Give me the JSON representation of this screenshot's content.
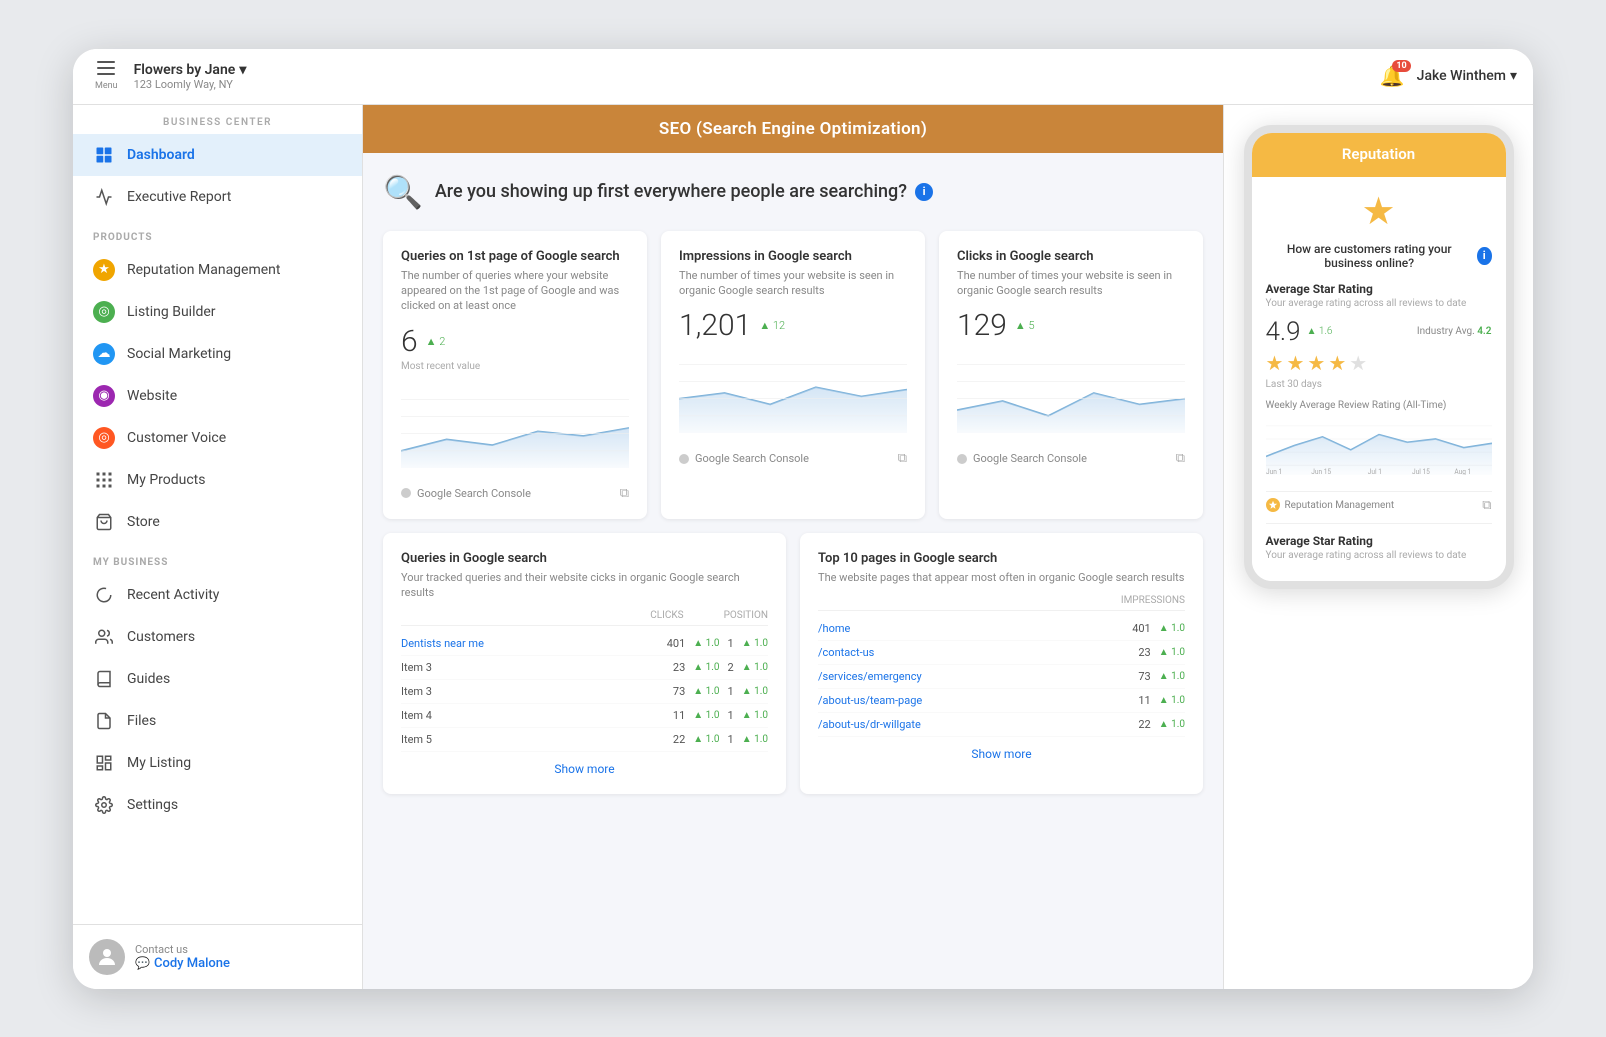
{
  "topBar": {
    "menuLabel": "Menu",
    "businessName": "Flowers by Jane",
    "businessAddress": "123 Loomly Way, NY",
    "notifCount": "10",
    "userName": "Jake Winthem"
  },
  "sidebar": {
    "businessCenterLabel": "Business Center",
    "items": [
      {
        "id": "dashboard",
        "label": "Dashboard",
        "icon": "dashboard",
        "active": true
      },
      {
        "id": "executive-report",
        "label": "Executive Report",
        "icon": "report",
        "active": false
      }
    ],
    "productsLabel": "Products",
    "products": [
      {
        "id": "reputation",
        "label": "Reputation Management",
        "icon": "reputation"
      },
      {
        "id": "listing",
        "label": "Listing Builder",
        "icon": "listing"
      },
      {
        "id": "social",
        "label": "Social Marketing",
        "icon": "social"
      },
      {
        "id": "website",
        "label": "Website",
        "icon": "website"
      },
      {
        "id": "customer-voice",
        "label": "Customer Voice",
        "icon": "customer"
      },
      {
        "id": "my-products",
        "label": "My Products",
        "icon": "grid"
      },
      {
        "id": "store",
        "label": "Store",
        "icon": "store"
      }
    ],
    "myBusinessLabel": "My Business",
    "business": [
      {
        "id": "recent-activity",
        "label": "Recent Activity",
        "icon": "activity"
      },
      {
        "id": "customers",
        "label": "Customers",
        "icon": "customers"
      },
      {
        "id": "guides",
        "label": "Guides",
        "icon": "guides"
      },
      {
        "id": "files",
        "label": "Files",
        "icon": "files"
      },
      {
        "id": "my-listing",
        "label": "My Listing",
        "icon": "listing-b"
      },
      {
        "id": "settings",
        "label": "Settings",
        "icon": "settings"
      }
    ],
    "contactUsLabel": "Contact us",
    "contactName": "Cody Malone"
  },
  "pageHeader": "SEO (Search Engine Optimization)",
  "searchBanner": {
    "question": "Are you showing up first everywhere people are searching?",
    "infoTooltip": "i"
  },
  "cards": [
    {
      "title": "Queries on 1st page of Google search",
      "desc": "The number of queries where your website appeared on the 1st page of Google and was clicked on at least once",
      "value": "6",
      "change": "2",
      "mostRecent": "Most recent value",
      "source": "Google Search Console"
    },
    {
      "title": "Impressions in Google search",
      "desc": "The number of times your website is seen in organic Google search results",
      "value": "1,201",
      "change": "12",
      "mostRecent": "",
      "source": "Google Search Console"
    },
    {
      "title": "Clicks in Google search",
      "desc": "The number of times your website is seen in organic Google search results",
      "value": "129",
      "change": "5",
      "mostRecent": "",
      "source": "Google Search Console"
    }
  ],
  "tableCards": [
    {
      "title": "Queries in Google search",
      "desc": "Your tracked queries and their website cicks in organic Google search results",
      "headers": [
        "",
        "Clicks",
        "Position"
      ],
      "rows": [
        {
          "label": "Dentists near me",
          "clicks": "401",
          "clicksChange": "1.0",
          "pos": "1",
          "posChange": "1.0",
          "isLink": true
        },
        {
          "label": "Item 3",
          "clicks": "23",
          "clicksChange": "1.0",
          "pos": "2",
          "posChange": "1.0",
          "isLink": false
        },
        {
          "label": "Item 3",
          "clicks": "73",
          "clicksChange": "1.0",
          "pos": "1",
          "posChange": "1.0",
          "isLink": false
        },
        {
          "label": "Item 4",
          "clicks": "11",
          "clicksChange": "1.0",
          "pos": "1",
          "posChange": "1.0",
          "isLink": false
        },
        {
          "label": "Item 5",
          "clicks": "22",
          "clicksChange": "1.0",
          "pos": "1",
          "posChange": "1.0",
          "isLink": false
        }
      ],
      "showMore": "Show more"
    },
    {
      "title": "Top 10 pages in Google search",
      "desc": "The website pages that appear most often in organic Google search results",
      "headers": [
        "",
        "Impressions"
      ],
      "rows": [
        {
          "label": "/home",
          "clicks": "401",
          "clicksChange": "1.0",
          "pos": "",
          "posChange": "1.0",
          "isLink": true
        },
        {
          "label": "/contact-us",
          "clicks": "23",
          "clicksChange": "1.0",
          "pos": "",
          "posChange": "1.0",
          "isLink": true
        },
        {
          "label": "/services/emergency",
          "clicks": "73",
          "clicksChange": "1.0",
          "pos": "",
          "posChange": "1.0",
          "isLink": true
        },
        {
          "label": "/about-us/team-page",
          "clicks": "11",
          "clicksChange": "1.0",
          "pos": "",
          "posChange": "1.0",
          "isLink": true
        },
        {
          "label": "/about-us/dr-willgate",
          "clicks": "22",
          "clicksChange": "1.0",
          "pos": "",
          "posChange": "1.0",
          "isLink": true
        }
      ],
      "showMore": "Show more"
    }
  ],
  "chartLabels": [
    "Jun 1",
    "Jun 15",
    "Jul 1",
    "Jul 15",
    "Aug 1"
  ],
  "phonePanel": {
    "header": "Reputation",
    "starQuestion": "How are customers rating your business online?",
    "infoTooltip": "i",
    "avgStarLabel": "Average Star Rating",
    "avgStarSub": "Your average rating across all reviews to date",
    "ratingValue": "4.9",
    "ratingChange": "1.6",
    "industryAvgLabel": "Industry Avg.",
    "industryAvgValue": "4.2",
    "lastDays": "Last 30 days",
    "weeklyTitle": "Weekly Average Review Rating (All-Time)",
    "weeklyLabels": [
      "Jun 1",
      "Jun 15",
      "Jul 1",
      "Jul 15",
      "Aug 1"
    ],
    "sourceLabel": "Reputation Management",
    "avgStarLabel2": "Average Star Rating",
    "avgStarSub2": "Your average rating across all reviews to date"
  }
}
